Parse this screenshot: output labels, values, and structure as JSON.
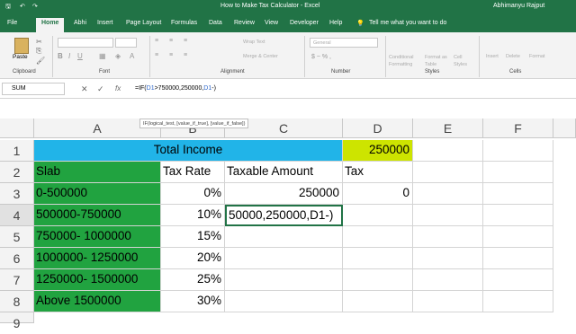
{
  "window": {
    "title": "How to Make Tax Calculator  -  Excel",
    "user": "Abhimanyu Rajput"
  },
  "tabs": [
    "File",
    "Home",
    "Abhi",
    "Insert",
    "Page Layout",
    "Formulas",
    "Data",
    "Review",
    "View",
    "Developer",
    "Help"
  ],
  "tell_me": "Tell me what you want to do",
  "ribbon": {
    "paste": "Paste",
    "groups": [
      "Clipboard",
      "Font",
      "Alignment",
      "Number",
      "Styles",
      "Cells"
    ],
    "wrap_text": "Wrap Text",
    "merge_center": "Merge & Center",
    "number_format": "General",
    "styles": [
      "Conditional Formatting",
      "Format as Table",
      "Cell Styles"
    ],
    "cells": [
      "Insert",
      "Delete",
      "Format"
    ]
  },
  "formula_bar": {
    "name_box": "SUM",
    "fx": "fx",
    "formula_prefix": "=IF(",
    "formula_ref": "D1",
    "formula_mid": ">750000,250000,",
    "formula_ref2": "D1",
    "formula_suffix": "-)",
    "tooltip": "IF(logical_test, [value_if_true], [value_if_false])"
  },
  "columns": [
    "A",
    "B",
    "C",
    "D",
    "E",
    "F"
  ],
  "rows": [
    "1",
    "2",
    "3",
    "4",
    "5",
    "6",
    "7",
    "8",
    "9"
  ],
  "sheet": {
    "total_income_label": "Total Income",
    "total_income_value": "250000",
    "headers": [
      "Slab",
      "Tax Rate",
      "Taxable Amount",
      "Tax"
    ],
    "slabs": [
      "0-500000",
      "500000-750000",
      "750000- 1000000",
      "1000000- 1250000",
      "1250000- 1500000",
      "Above 1500000"
    ],
    "rates": [
      "0%",
      "10%",
      "15%",
      "20%",
      "25%",
      "30%"
    ],
    "taxable_c3": "250000",
    "tax_d3": "0",
    "editing_c4": "50000,250000,D1-)"
  },
  "colors": {
    "excel_green": "#217346",
    "slab_green": "#21a340",
    "income_blue": "#21b4e8",
    "value_yellow": "#cde400"
  }
}
